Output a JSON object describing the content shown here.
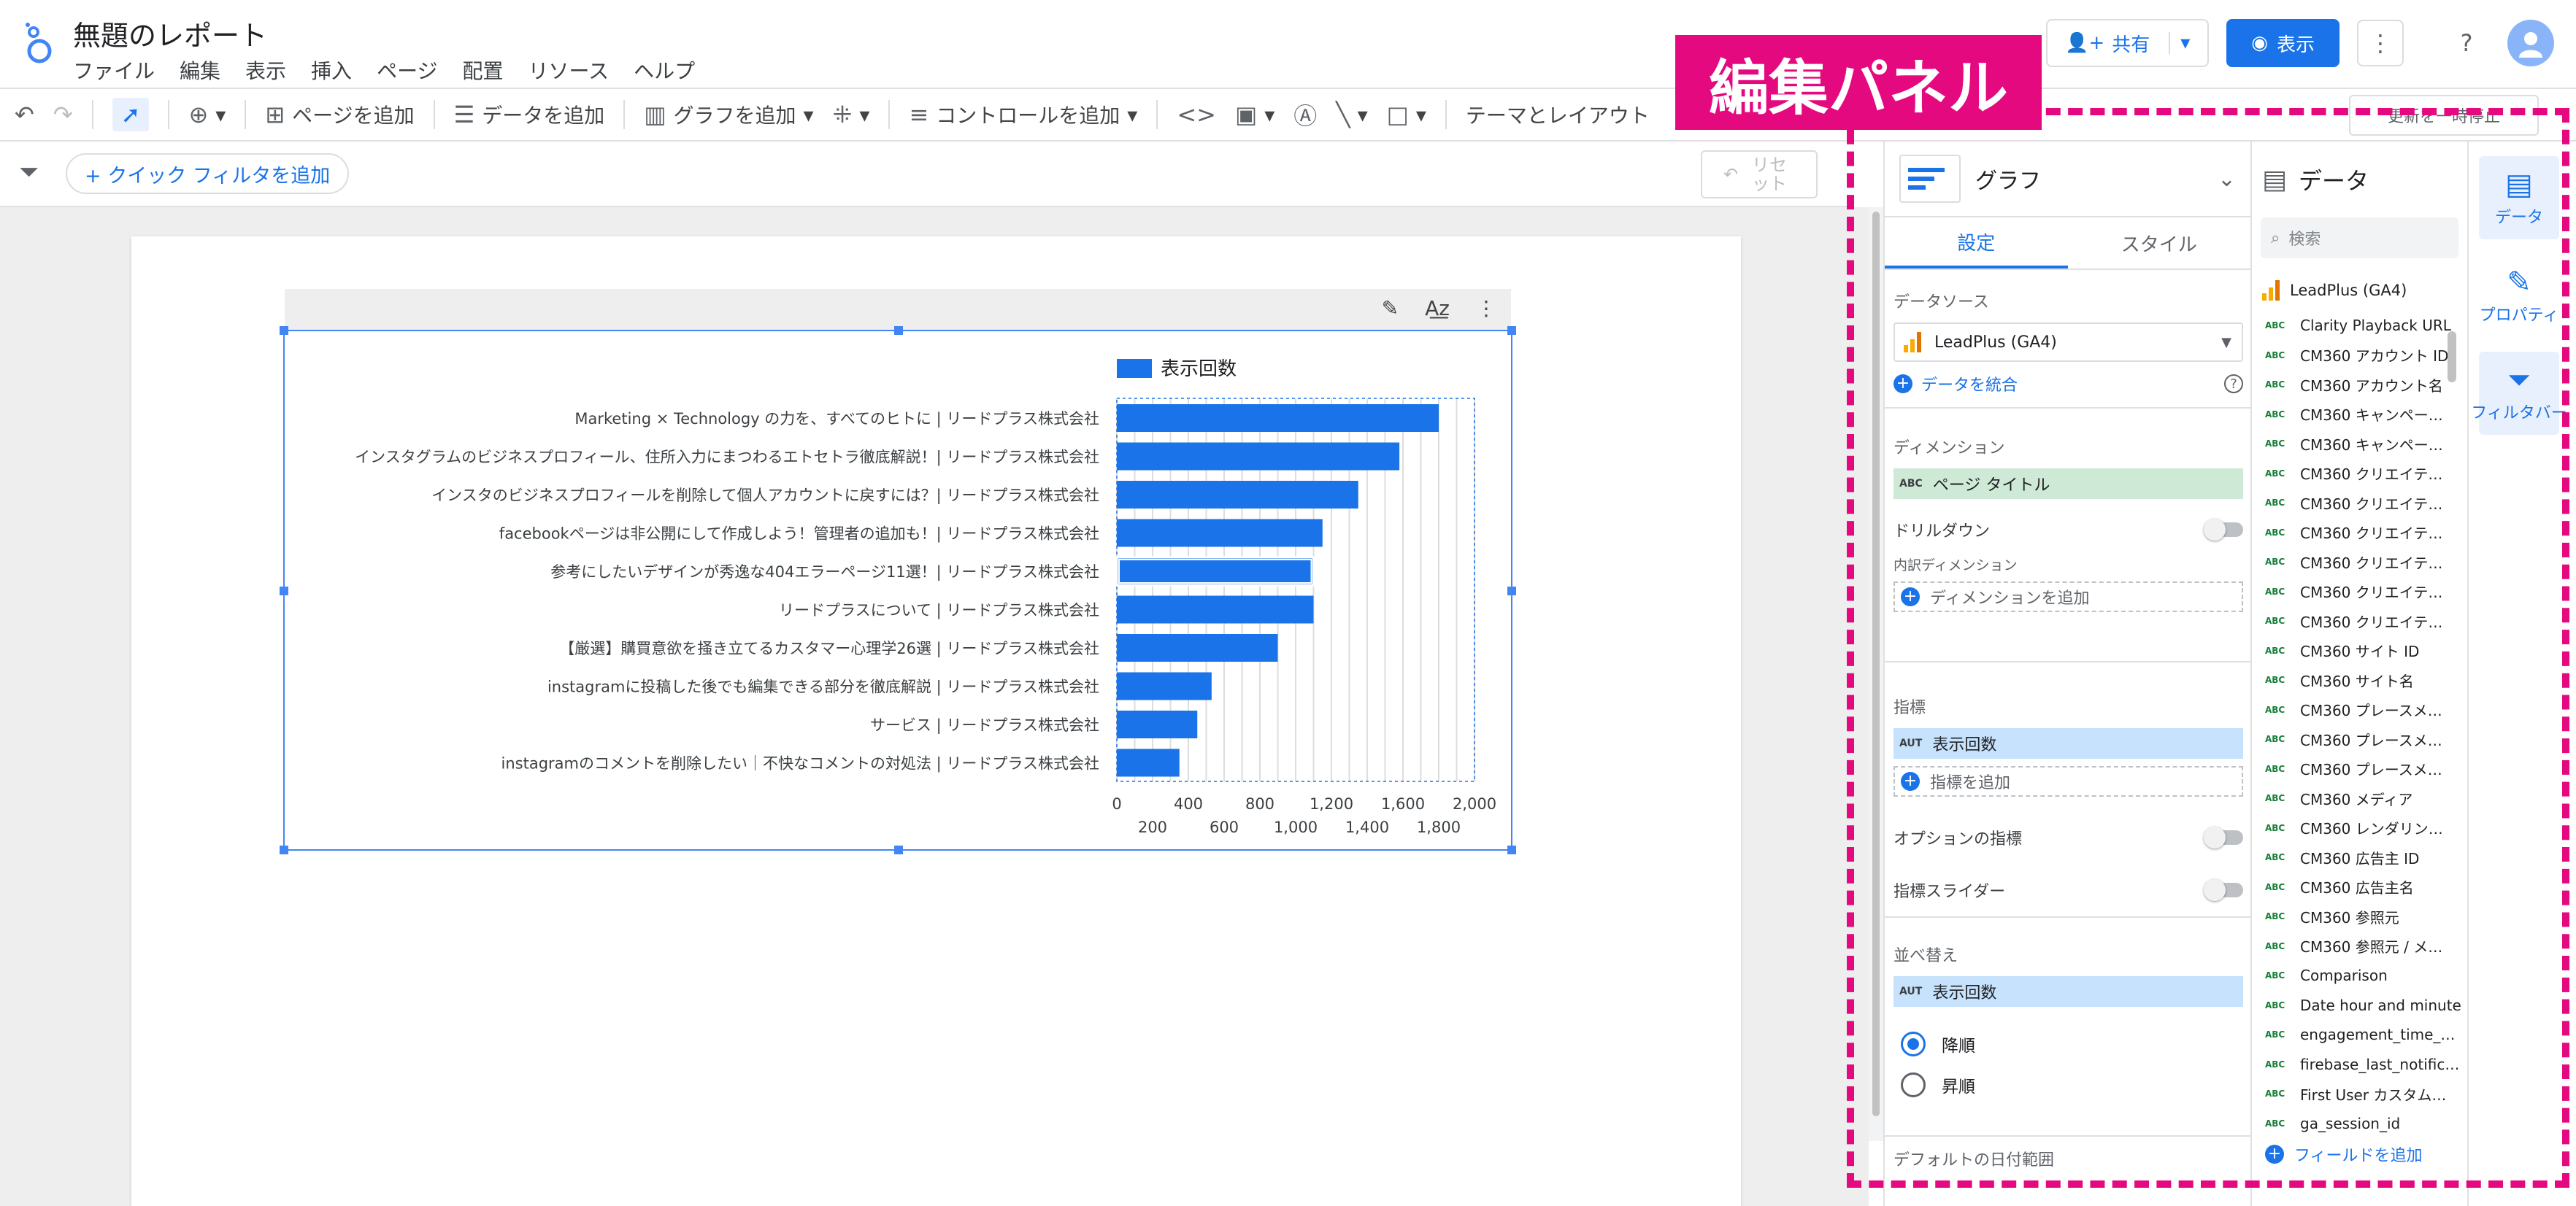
{
  "app": {
    "title": "無題のレポート",
    "menu": [
      "ファイル",
      "編集",
      "表示",
      "挿入",
      "ページ",
      "配置",
      "リソース",
      "ヘルプ"
    ],
    "share_label": "共有",
    "view_label": "表示"
  },
  "toolbar": {
    "add_page": "ページを追加",
    "add_data": "データを追加",
    "add_chart": "グラフを追加",
    "add_control": "コントロールを追加",
    "theme_layout": "テーマとレイアウト"
  },
  "filterbar": {
    "quick_filter": "+ クイック フィルタを追加",
    "reset": "リセット"
  },
  "chart_data": {
    "type": "bar",
    "orientation": "horizontal",
    "legend": [
      "表示回数"
    ],
    "legend_position": "top",
    "categories": [
      "Marketing × Technology の力を、すべてのヒトに | リードプラス株式会社",
      "インスタグラムのビジネスプロフィール、住所入力にまつわるエトセトラ徹底解説！| リードプラス株式会社",
      "インスタのビジネスプロフィールを削除して個人アカウントに戻すには？| リードプラス株式会社",
      "facebookページは非公開にして作成しよう！管理者の追加も！| リードプラス株式会社",
      "参考にしたいデザインが秀逸な404エラーページ11選！| リードプラス株式会社",
      "リードプラスについて | リードプラス株式会社",
      "【厳選】購買意欲を掻き立てるカスタマー心理学26選 | リードプラス株式会社",
      "instagramに投稿した後でも編集できる部分を徹底解説 | リードプラス株式会社",
      "サービス | リードプラス株式会社",
      "instagramのコメントを削除したい｜不快なコメントの対処法 | リードプラス株式会社"
    ],
    "series": [
      {
        "name": "表示回数",
        "values": [
          1800,
          1580,
          1350,
          1150,
          1100,
          1100,
          900,
          530,
          450,
          350
        ]
      }
    ],
    "xlim": [
      0,
      2000
    ],
    "x_ticks_top": [
      "0",
      "400",
      "800",
      "1,200",
      "1,600",
      "2,000"
    ],
    "x_ticks_bottom": [
      "200",
      "600",
      "1,000",
      "1,400",
      "1,800"
    ],
    "color": "#1a73e8"
  },
  "annotation": {
    "label": "編集パネル",
    "color": "#e4097f"
  },
  "graph_panel": {
    "title": "グラフ",
    "tab_setup": "設定",
    "tab_style": "スタイル",
    "datasource_label": "データソース",
    "datasource_value": "LeadPlus (GA4)",
    "blend_label": "データを統合",
    "dimension_label": "ディメンション",
    "dimension_value": "ページ タイトル",
    "drilldown_label": "ドリルダウン",
    "breakdown_label": "内訳ディメンション",
    "add_dimension": "ディメンションを追加",
    "metric_label": "指標",
    "metric_value": "表示回数",
    "add_metric": "指標を追加",
    "optional_metrics": "オプションの指標",
    "metric_slider": "指標スライダー",
    "sort_label": "並べ替え",
    "sort_value": "表示回数",
    "sort_desc": "降順",
    "sort_asc": "昇順",
    "default_date": "デフォルトの日付範囲"
  },
  "data_panel": {
    "title": "データ",
    "search_placeholder": "検索",
    "source": "LeadPlus (GA4)",
    "fields": [
      "Clarity Playback URL",
      "CM360 アカウント ID",
      "CM360 アカウント名",
      "CM360 キャンペー…",
      "CM360 キャンペー…",
      "CM360 クリエイテ…",
      "CM360 クリエイテ…",
      "CM360 クリエイテ…",
      "CM360 クリエイテ…",
      "CM360 クリエイテ…",
      "CM360 クリエイテ…",
      "CM360 サイト ID",
      "CM360 サイト名",
      "CM360 プレースメ…",
      "CM360 プレースメ…",
      "CM360 プレースメ…",
      "CM360 メディア",
      "CM360 レンダリン…",
      "CM360 広告主 ID",
      "CM360 広告主名",
      "CM360 参照元",
      "CM360 参照元 / メ…",
      "Comparison",
      "Date hour and minute",
      "engagement_time_…",
      "firebase_last_notific…",
      "First User カスタム…",
      "ga_session_id"
    ],
    "add_field": "フィールドを追加"
  },
  "rail": {
    "data": "データ",
    "properties": "プロパティ",
    "filter": "フィルタバー"
  },
  "update_btn": "更新を一時停止"
}
